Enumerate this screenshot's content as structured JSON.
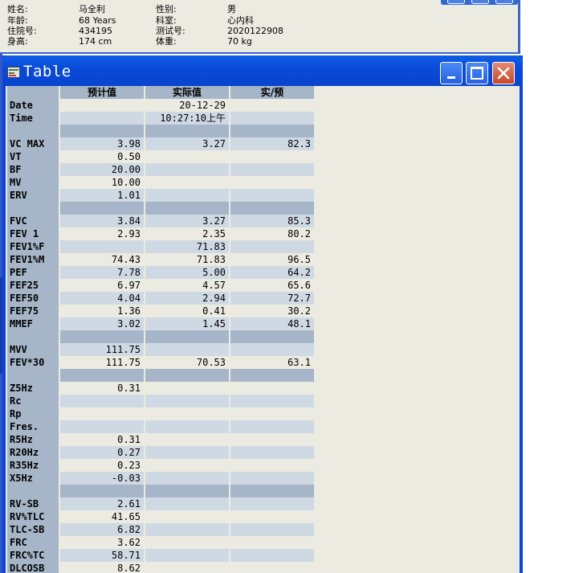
{
  "patient_info": {
    "rows": [
      {
        "label1": "姓名:",
        "value1": "马全利",
        "label2": "性别:",
        "value2": "男"
      },
      {
        "label1": "年龄:",
        "value1": "68 Years",
        "label2": "科室:",
        "value2": "心内科"
      },
      {
        "label1": "住院号:",
        "value1": "434195",
        "label2": "测试号:",
        "value2": "2020122908"
      },
      {
        "label1": "身高:",
        "value1": "174 cm",
        "label2": "体重:",
        "value2": "70 kg"
      }
    ]
  },
  "window": {
    "title": "Table",
    "icons": {
      "app": "table-app-icon",
      "minimize": "minimize-icon",
      "maximize": "maximize-icon",
      "close": "close-icon"
    }
  },
  "table": {
    "headers": [
      "",
      "预计值",
      "实际值",
      "实/预"
    ],
    "rows": [
      {
        "label": "Date",
        "pred": "",
        "actual": "20-12-29",
        "ratio": ""
      },
      {
        "label": "Time",
        "pred": "",
        "actual": "10:27:10上午",
        "ratio": ""
      },
      {
        "label": "",
        "pred": "",
        "actual": "",
        "ratio": "",
        "sep": true
      },
      {
        "label": "VC MAX",
        "pred": "3.98",
        "actual": "3.27",
        "ratio": "82.3"
      },
      {
        "label": "VT",
        "pred": "0.50",
        "actual": "",
        "ratio": ""
      },
      {
        "label": "BF",
        "pred": "20.00",
        "actual": "",
        "ratio": ""
      },
      {
        "label": "MV",
        "pred": "10.00",
        "actual": "",
        "ratio": ""
      },
      {
        "label": "ERV",
        "pred": "1.01",
        "actual": "",
        "ratio": ""
      },
      {
        "label": "",
        "pred": "",
        "actual": "",
        "ratio": "",
        "sep": true
      },
      {
        "label": "FVC",
        "pred": "3.84",
        "actual": "3.27",
        "ratio": "85.3"
      },
      {
        "label": "FEV 1",
        "pred": "2.93",
        "actual": "2.35",
        "ratio": "80.2"
      },
      {
        "label": "FEV1%F",
        "pred": "",
        "actual": "71.83",
        "ratio": ""
      },
      {
        "label": "FEV1%M",
        "pred": "74.43",
        "actual": "71.83",
        "ratio": "96.5"
      },
      {
        "label": "PEF",
        "pred": "7.78",
        "actual": "5.00",
        "ratio": "64.2"
      },
      {
        "label": "FEF25",
        "pred": "6.97",
        "actual": "4.57",
        "ratio": "65.6"
      },
      {
        "label": "FEF50",
        "pred": "4.04",
        "actual": "2.94",
        "ratio": "72.7"
      },
      {
        "label": "FEF75",
        "pred": "1.36",
        "actual": "0.41",
        "ratio": "30.2"
      },
      {
        "label": "MMEF",
        "pred": "3.02",
        "actual": "1.45",
        "ratio": "48.1"
      },
      {
        "label": "",
        "pred": "",
        "actual": "",
        "ratio": "",
        "sep": true
      },
      {
        "label": "MVV",
        "pred": "111.75",
        "actual": "",
        "ratio": ""
      },
      {
        "label": "FEV*30",
        "pred": "111.75",
        "actual": "70.53",
        "ratio": "63.1"
      },
      {
        "label": "",
        "pred": "",
        "actual": "",
        "ratio": "",
        "sep": true
      },
      {
        "label": "Z5Hz",
        "pred": "0.31",
        "actual": "",
        "ratio": ""
      },
      {
        "label": "Rc",
        "pred": "",
        "actual": "",
        "ratio": ""
      },
      {
        "label": "Rp",
        "pred": "",
        "actual": "",
        "ratio": ""
      },
      {
        "label": "Fres.",
        "pred": "",
        "actual": "",
        "ratio": ""
      },
      {
        "label": "R5Hz",
        "pred": "0.31",
        "actual": "",
        "ratio": ""
      },
      {
        "label": "R20Hz",
        "pred": "0.27",
        "actual": "",
        "ratio": ""
      },
      {
        "label": "R35Hz",
        "pred": "0.23",
        "actual": "",
        "ratio": ""
      },
      {
        "label": "X5Hz",
        "pred": "-0.03",
        "actual": "",
        "ratio": ""
      },
      {
        "label": "",
        "pred": "",
        "actual": "",
        "ratio": "",
        "sep": true
      },
      {
        "label": "RV-SB",
        "pred": "2.61",
        "actual": "",
        "ratio": ""
      },
      {
        "label": "RV%TLC",
        "pred": "41.65",
        "actual": "",
        "ratio": ""
      },
      {
        "label": "TLC-SB",
        "pred": "6.82",
        "actual": "",
        "ratio": ""
      },
      {
        "label": "FRC",
        "pred": "3.62",
        "actual": "",
        "ratio": ""
      },
      {
        "label": "FRC%TC",
        "pred": "58.71",
        "actual": "",
        "ratio": ""
      },
      {
        "label": "DLCOSB",
        "pred": "8.62",
        "actual": "",
        "ratio": ""
      }
    ]
  },
  "colors": {
    "titlebar": "#0a49d8",
    "header_cell": "#a6b6c8",
    "row_light": "#ecebe2",
    "row_alt": "#cfd9e4",
    "close_button": "#c84627"
  }
}
